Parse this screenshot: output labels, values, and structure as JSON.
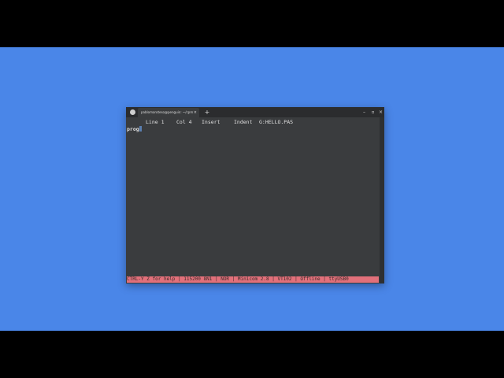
{
  "window": {
    "tab_title": "pablomaroteso@penguin: ~/cpm/c",
    "tab_close": "×",
    "new_tab": "+",
    "minimize": "–",
    "maximize": "▫",
    "close": "×"
  },
  "editor": {
    "line": "Line 1",
    "col": "Col 4",
    "mode": "Insert",
    "indent": "Indent",
    "file": "G:HELLO.PAS",
    "content": "prog"
  },
  "statusbar": {
    "text": "CTRL-Y Z for help | 115200 8N1 | NOR | Minicom 2.8 | VT102 | Offline | ttyUSB0"
  },
  "colors": {
    "desktop": "#4a86e8",
    "terminal_bg": "#3a3c3e",
    "statusbar_bg": "#e2707a",
    "cursor": "#5a7fb0"
  }
}
